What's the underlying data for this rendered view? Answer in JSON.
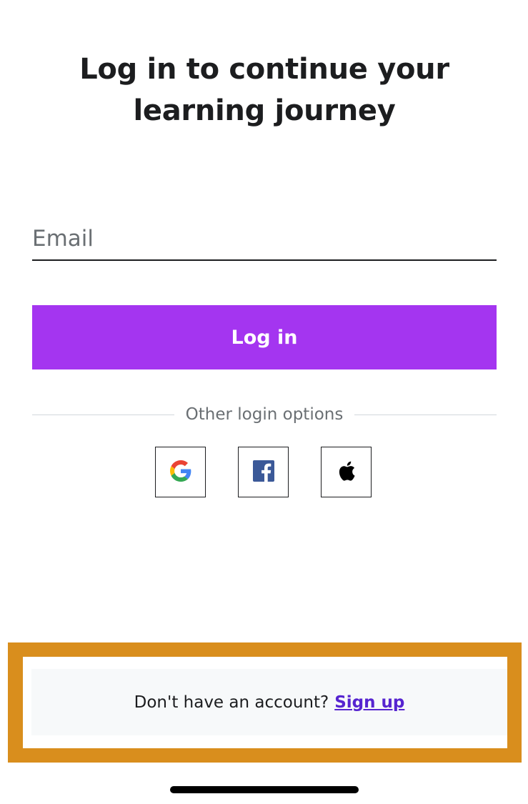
{
  "header": {
    "title": "Log in to continue your learning journey"
  },
  "form": {
    "email_placeholder": "Email",
    "email_value": "",
    "login_label": "Log in"
  },
  "other_options": {
    "label": "Other login options",
    "providers": [
      {
        "name": "Google",
        "icon": "google-icon"
      },
      {
        "name": "Facebook",
        "icon": "facebook-icon"
      },
      {
        "name": "Apple",
        "icon": "apple-icon"
      }
    ]
  },
  "signup": {
    "prompt": "Don't have an account?",
    "link_label": "Sign up"
  },
  "colors": {
    "accent": "#a435f0",
    "link": "#5624d0",
    "highlight": "#d98e1d",
    "text": "#1c1d1f",
    "muted": "#6a6f73",
    "panel": "#f7f9fa"
  }
}
